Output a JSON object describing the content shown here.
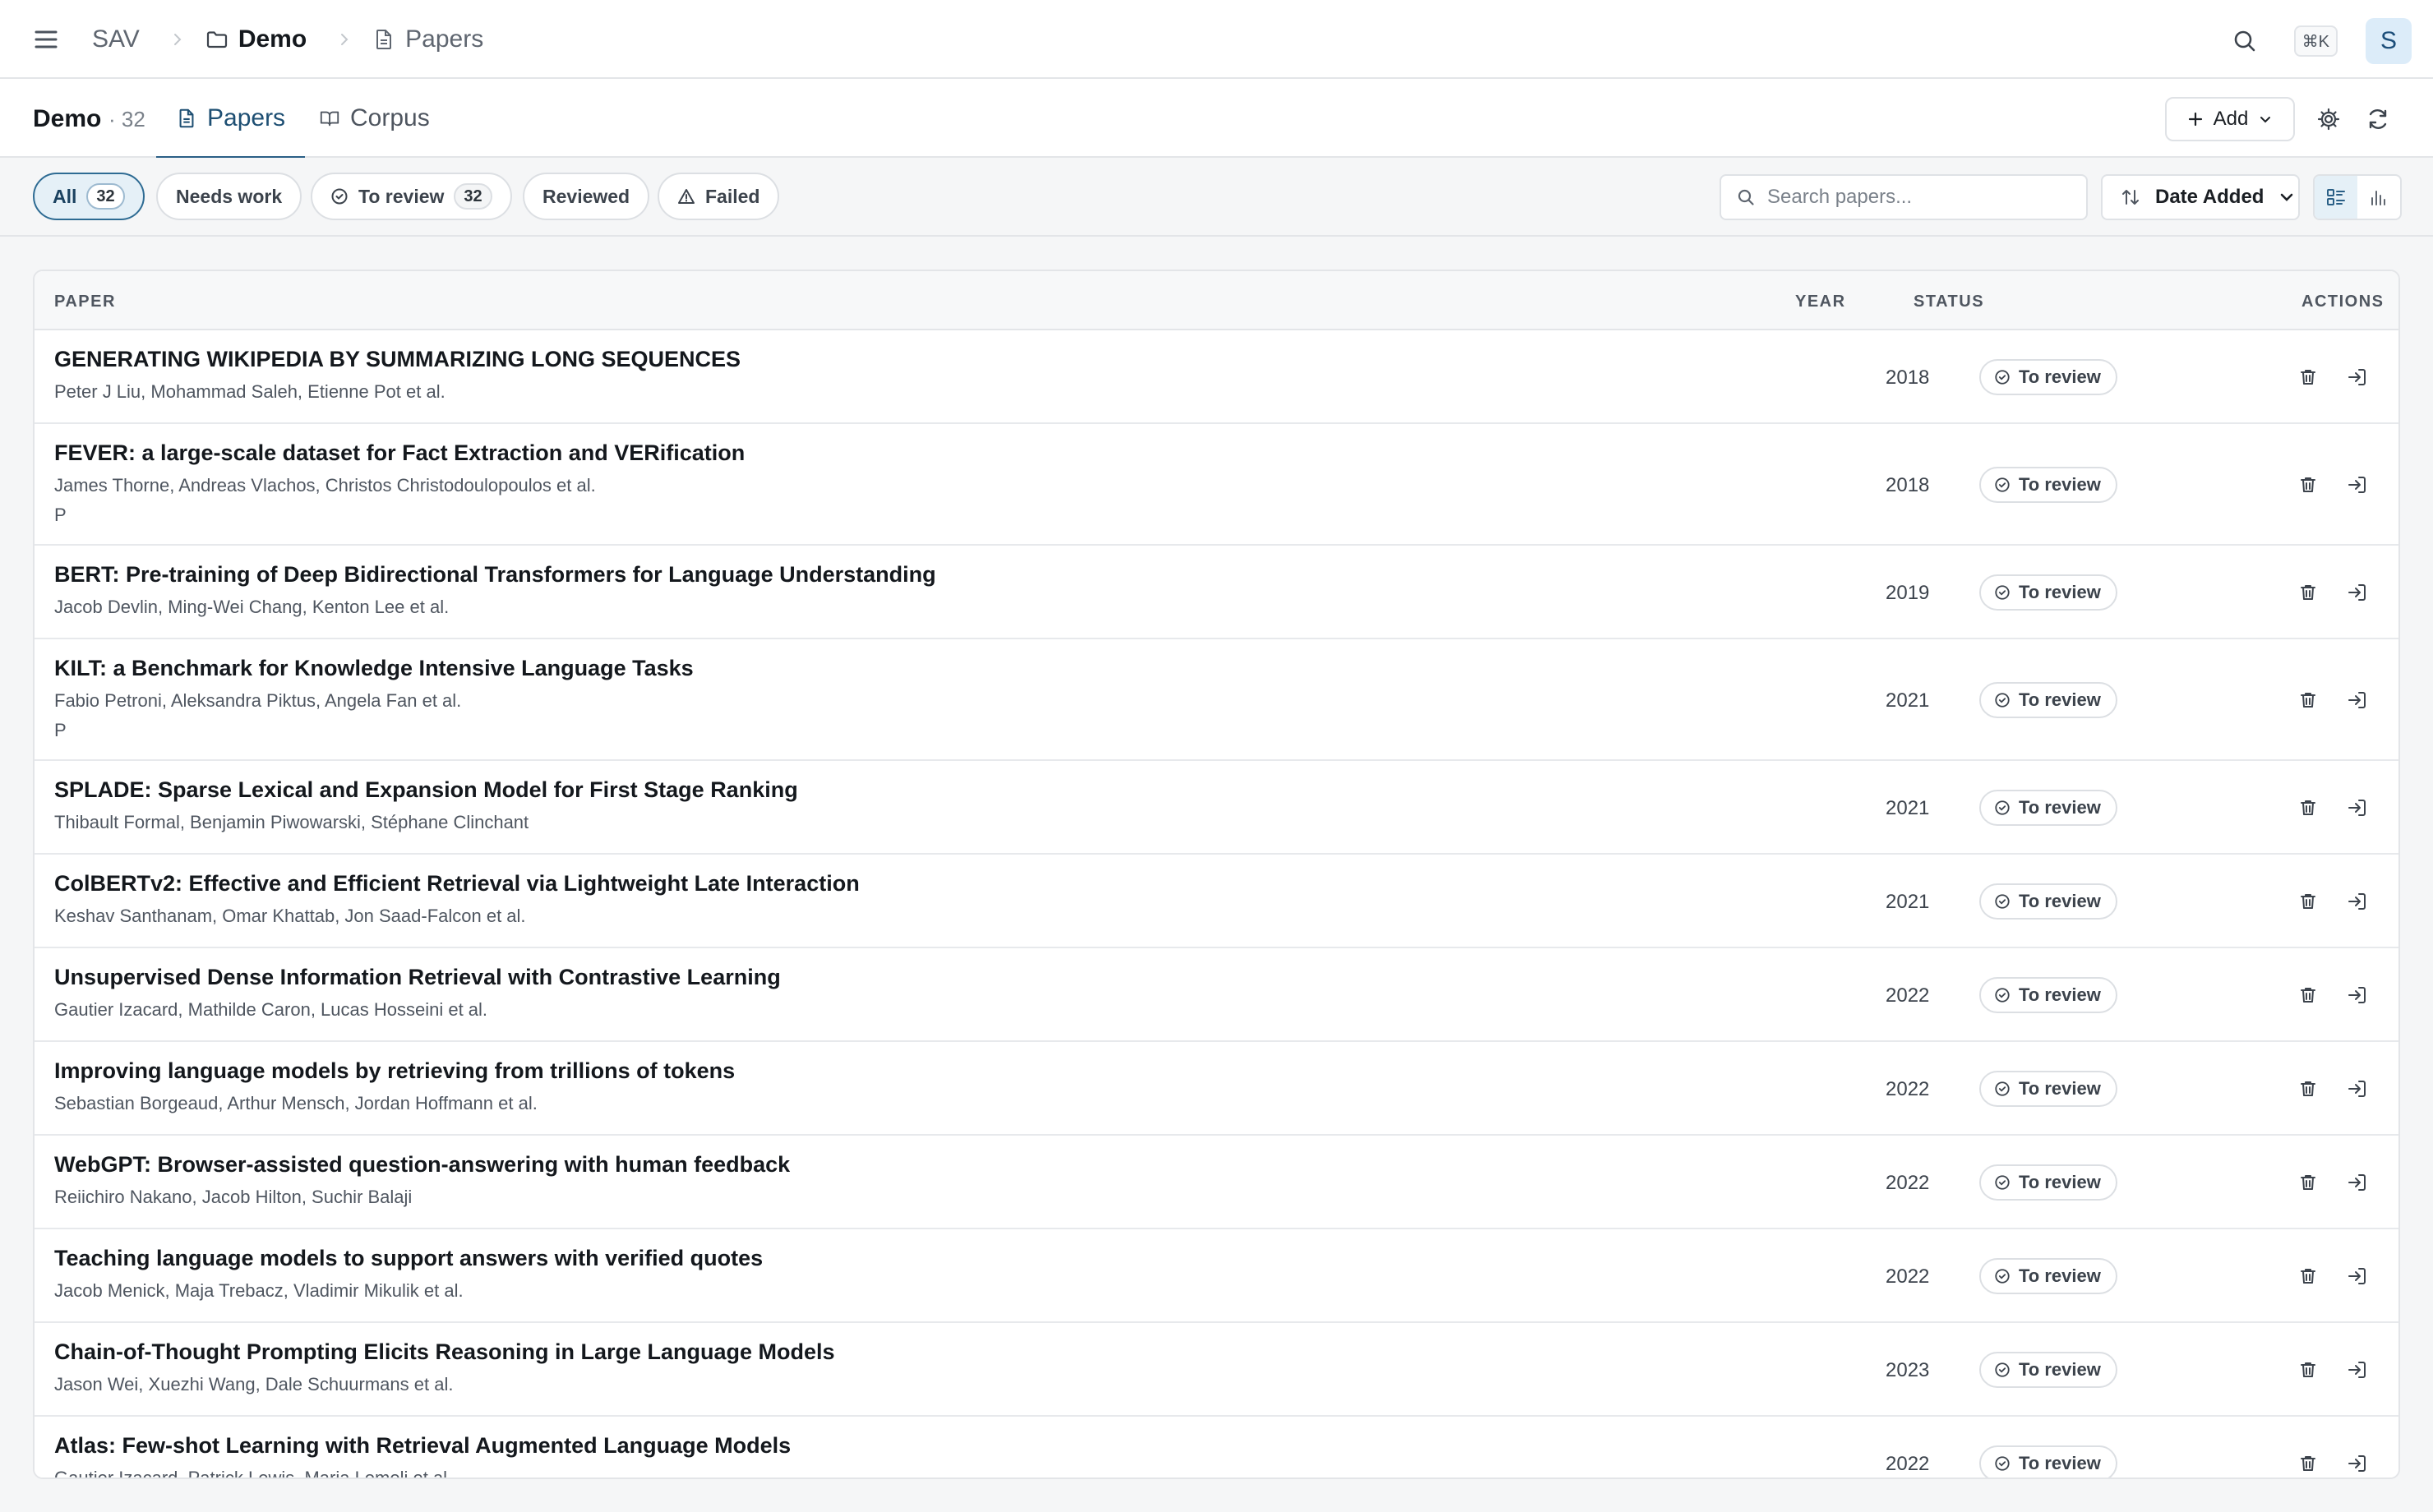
{
  "topbar": {
    "root": "SAV",
    "crumb_project": "Demo",
    "crumb_page": "Papers",
    "shortcut": "⌘K",
    "avatar_initial": "S"
  },
  "subheader": {
    "project": "Demo",
    "count": "· 32",
    "tabs": [
      {
        "label": "Papers",
        "active": true
      },
      {
        "label": "Corpus",
        "active": false
      }
    ],
    "add_label": "Add"
  },
  "filters": {
    "chips": [
      {
        "label": "All",
        "badge": "32",
        "active": true
      },
      {
        "label": "Needs work",
        "badge": null
      },
      {
        "label": "To review",
        "badge": "32"
      },
      {
        "label": "Reviewed",
        "badge": null
      },
      {
        "label": "Failed",
        "badge": null
      }
    ],
    "search_placeholder": "Search papers...",
    "sort_label": "Date Added"
  },
  "table": {
    "headers": {
      "paper": "PAPER",
      "year": "YEAR",
      "status": "STATUS",
      "actions": "ACTIONS"
    },
    "rows": [
      {
        "title": "GENERATING WIKIPEDIA BY SUMMARIZING LONG SEQUENCES",
        "authors": "Peter J Liu, Mohammad Saleh, Etienne Pot et al.",
        "extra": "",
        "year": "2018",
        "status": "To review"
      },
      {
        "title": "FEVER: a large-scale dataset for Fact Extraction and VERification",
        "authors": "James Thorne, Andreas Vlachos, Christos Christodoulopoulos et al.",
        "extra": "P",
        "year": "2018",
        "status": "To review"
      },
      {
        "title": "BERT: Pre-training of Deep Bidirectional Transformers for Language Understanding",
        "authors": "Jacob Devlin, Ming-Wei Chang, Kenton Lee et al.",
        "extra": "",
        "year": "2019",
        "status": "To review"
      },
      {
        "title": "KILT: a Benchmark for Knowledge Intensive Language Tasks",
        "authors": "Fabio Petroni, Aleksandra Piktus, Angela Fan et al.",
        "extra": "P",
        "year": "2021",
        "status": "To review"
      },
      {
        "title": "SPLADE: Sparse Lexical and Expansion Model for First Stage Ranking",
        "authors": "Thibault Formal, Benjamin Piwowarski, Stéphane Clinchant",
        "extra": "",
        "year": "2021",
        "status": "To review"
      },
      {
        "title": "ColBERTv2: Effective and Efficient Retrieval via Lightweight Late Interaction",
        "authors": "Keshav Santhanam, Omar Khattab, Jon Saad-Falcon et al.",
        "extra": "",
        "year": "2021",
        "status": "To review"
      },
      {
        "title": "Unsupervised Dense Information Retrieval with Contrastive Learning",
        "authors": "Gautier Izacard, Mathilde Caron, Lucas Hosseini et al.",
        "extra": "",
        "year": "2022",
        "status": "To review"
      },
      {
        "title": "Improving language models by retrieving from trillions of tokens",
        "authors": "Sebastian Borgeaud, Arthur Mensch, Jordan Hoffmann et al.",
        "extra": "",
        "year": "2022",
        "status": "To review"
      },
      {
        "title": "WebGPT: Browser-assisted question-answering with human feedback",
        "authors": "Reiichiro Nakano, Jacob Hilton, Suchir Balaji",
        "extra": "",
        "year": "2022",
        "status": "To review"
      },
      {
        "title": "Teaching language models to support answers with verified quotes",
        "authors": "Jacob Menick, Maja Trebacz, Vladimir Mikulik et al.",
        "extra": "",
        "year": "2022",
        "status": "To review"
      },
      {
        "title": "Chain-of-Thought Prompting Elicits Reasoning in Large Language Models",
        "authors": "Jason Wei, Xuezhi Wang, Dale Schuurmans et al.",
        "extra": "",
        "year": "2023",
        "status": "To review"
      },
      {
        "title": "Atlas: Few-shot Learning with Retrieval Augmented Language Models",
        "authors": "Gautier Izacard, Patrick Lewis, Maria Lomeli et al.",
        "extra": "",
        "year": "2022",
        "status": "To review"
      }
    ]
  }
}
